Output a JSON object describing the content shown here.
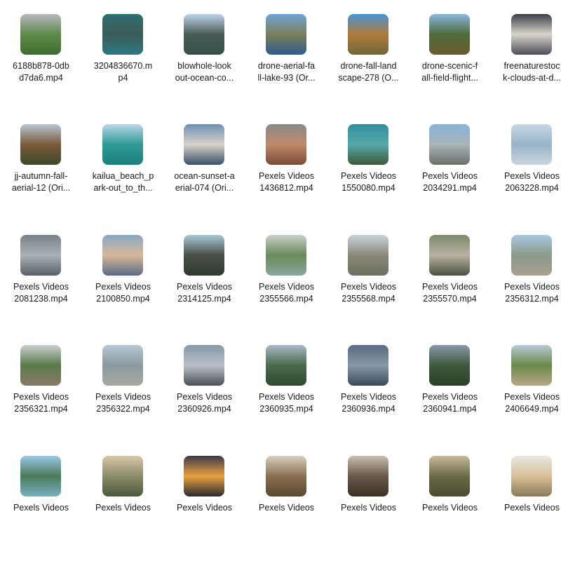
{
  "files": [
    {
      "name": "6188b878-0dbd7da6.mp4",
      "thumb_label": "6188b878-0db\nd7da6.mp4",
      "thumb": {
        "top": "#b8b8c0",
        "mid": "#5e8a4a",
        "bottom": "#3f6b32"
      }
    },
    {
      "name": "3204836670.mp4",
      "thumb_label": "3204836670.m\np4",
      "thumb": {
        "top": "#2f6f73",
        "mid": "#3b5b56",
        "bottom": "#2a7a80"
      }
    },
    {
      "name": "blowhole-lookout-ocean-co...",
      "thumb_label": "blowhole-look\nout-ocean-co...",
      "thumb": {
        "top": "#bcd4ea",
        "mid": "#4a5c56",
        "bottom": "#35504a"
      }
    },
    {
      "name": "drone-aerial-fall-lake-93 (Ori...",
      "thumb_label": "drone-aerial-fa\nll-lake-93 (Or...",
      "thumb": {
        "top": "#6fa5d8",
        "mid": "#7a7f5c",
        "bottom": "#2f5a88"
      }
    },
    {
      "name": "drone-fall-landscape-278 (O...",
      "thumb_label": "drone-fall-land\nscape-278 (O...",
      "thumb": {
        "top": "#4a94d6",
        "mid": "#b07a3a",
        "bottom": "#6d6a3a"
      }
    },
    {
      "name": "drone-scenic-fall-field-flight...",
      "thumb_label": "drone-scenic-f\nall-field-flight...",
      "thumb": {
        "top": "#8ab7e0",
        "mid": "#4f6b3a",
        "bottom": "#6b5a30"
      }
    },
    {
      "name": "freenaturestock-clouds-at-d...",
      "thumb_label": "freenaturestoc\nk-clouds-at-d...",
      "thumb": {
        "top": "#3a3e48",
        "mid": "#d9d4cc",
        "bottom": "#4a4f58"
      }
    },
    {
      "name": "jj-autumn-fall-aerial-12 (Ori...",
      "thumb_label": "jj-autumn-fall-\naerial-12 (Ori...",
      "thumb": {
        "top": "#b7c7d6",
        "mid": "#7a5a38",
        "bottom": "#3e4a2e"
      }
    },
    {
      "name": "kailua_beach_park-out_to_th...",
      "thumb_label": "kailua_beach_p\nark-out_to_th...",
      "thumb": {
        "top": "#bcd7ea",
        "mid": "#2f9a94",
        "bottom": "#1f7f7a"
      }
    },
    {
      "name": "ocean-sunset-aerial-074 (Ori...",
      "thumb_label": "ocean-sunset-a\nerial-074 (Ori...",
      "thumb": {
        "top": "#6f8fb4",
        "mid": "#d8d2c8",
        "bottom": "#3a4e68"
      }
    },
    {
      "name": "Pexels Videos 1436812.mp4",
      "thumb_label": "Pexels Videos\n1436812.mp4",
      "thumb": {
        "top": "#8a8a8a",
        "mid": "#c08a6a",
        "bottom": "#7a4a38"
      }
    },
    {
      "name": "Pexels Videos 1550080.mp4",
      "thumb_label": "Pexels Videos\n1550080.mp4",
      "thumb": {
        "top": "#2f8fa0",
        "mid": "#58a8a8",
        "bottom": "#3b5a3a"
      }
    },
    {
      "name": "Pexels Videos 2034291.mp4",
      "thumb_label": "Pexels Videos\n2034291.mp4",
      "thumb": {
        "top": "#8ab4d8",
        "mid": "#a8b4b8",
        "bottom": "#6a7068"
      }
    },
    {
      "name": "Pexels Videos 2063228.mp4",
      "thumb_label": "Pexels Videos\n2063228.mp4",
      "thumb": {
        "top": "#c8d8e6",
        "mid": "#98b4c8",
        "bottom": "#c8d4de"
      }
    },
    {
      "name": "Pexels Videos 2081238.mp4",
      "thumb_label": "Pexels Videos\n2081238.mp4",
      "thumb": {
        "top": "#7a8088",
        "mid": "#a8b0b8",
        "bottom": "#5a6068"
      }
    },
    {
      "name": "Pexels Videos 2100850.mp4",
      "thumb_label": "Pexels Videos\n2100850.mp4",
      "thumb": {
        "top": "#8aa8c8",
        "mid": "#d8b898",
        "bottom": "#5a6a88"
      }
    },
    {
      "name": "Pexels Videos 2314125.mp4",
      "thumb_label": "Pexels Videos\n2314125.mp4",
      "thumb": {
        "top": "#a8c8d8",
        "mid": "#4a5048",
        "bottom": "#2e3a2e"
      }
    },
    {
      "name": "Pexels Videos 2355566.mp4",
      "thumb_label": "Pexels Videos\n2355566.mp4",
      "thumb": {
        "top": "#c8d0c8",
        "mid": "#6a8a5a",
        "bottom": "#8aa8a0"
      }
    },
    {
      "name": "Pexels Videos 2355568.mp4",
      "thumb_label": "Pexels Videos\n2355568.mp4",
      "thumb": {
        "top": "#c8d4dc",
        "mid": "#8a8878",
        "bottom": "#6a7060"
      }
    },
    {
      "name": "Pexels Videos 2355570.mp4",
      "thumb_label": "Pexels Videos\n2355570.mp4",
      "thumb": {
        "top": "#7a8a6a",
        "mid": "#b8b0a0",
        "bottom": "#4a5040"
      }
    },
    {
      "name": "Pexels Videos 2356312.mp4",
      "thumb_label": "Pexels Videos\n2356312.mp4",
      "thumb": {
        "top": "#a8c8e0",
        "mid": "#8a9a8a",
        "bottom": "#a8a090"
      }
    },
    {
      "name": "Pexels Videos 2356321.mp4",
      "thumb_label": "Pexels Videos\n2356321.mp4",
      "thumb": {
        "top": "#c8d0d0",
        "mid": "#5a7a4a",
        "bottom": "#8a7a68"
      }
    },
    {
      "name": "Pexels Videos 2356322.mp4",
      "thumb_label": "Pexels Videos\n2356322.mp4",
      "thumb": {
        "top": "#b8c8d4",
        "mid": "#8a9aa0",
        "bottom": "#a8a8a0"
      }
    },
    {
      "name": "Pexels Videos 2360926.mp4",
      "thumb_label": "Pexels Videos\n2360926.mp4",
      "thumb": {
        "top": "#8898a8",
        "mid": "#b8c0c8",
        "bottom": "#4a5058"
      }
    },
    {
      "name": "Pexels Videos 2360935.mp4",
      "thumb_label": "Pexels Videos\n2360935.mp4",
      "thumb": {
        "top": "#a8b8c8",
        "mid": "#4a6a4a",
        "bottom": "#2e4a30"
      }
    },
    {
      "name": "Pexels Videos 2360936.mp4",
      "thumb_label": "Pexels Videos\n2360936.mp4",
      "thumb": {
        "top": "#5a6a80",
        "mid": "#8898a8",
        "bottom": "#3a4858"
      }
    },
    {
      "name": "Pexels Videos 2360941.mp4",
      "thumb_label": "Pexels Videos\n2360941.mp4",
      "thumb": {
        "top": "#8898a8",
        "mid": "#3e5a3a",
        "bottom": "#2a4028"
      }
    },
    {
      "name": "Pexels Videos 2406649.mp4",
      "thumb_label": "Pexels Videos\n2406649.mp4",
      "thumb": {
        "top": "#b8c8d8",
        "mid": "#6a8a4a",
        "bottom": "#b8a888"
      }
    },
    {
      "name": "Pexels Videos",
      "thumb_label": "Pexels Videos",
      "thumb": {
        "top": "#9ac8e6",
        "mid": "#4a7a5a",
        "bottom": "#7ab0c0"
      }
    },
    {
      "name": "Pexels Videos",
      "thumb_label": "Pexels Videos",
      "thumb": {
        "top": "#d8c8a8",
        "mid": "#8a8a6a",
        "bottom": "#4a5a3a"
      }
    },
    {
      "name": "Pexels Videos",
      "thumb_label": "Pexels Videos",
      "thumb": {
        "top": "#3a3a48",
        "mid": "#e8a040",
        "bottom": "#2a2a30"
      }
    },
    {
      "name": "Pexels Videos",
      "thumb_label": "Pexels Videos",
      "thumb": {
        "top": "#d8d0c0",
        "mid": "#8a7050",
        "bottom": "#5a4830"
      }
    },
    {
      "name": "Pexels Videos",
      "thumb_label": "Pexels Videos",
      "thumb": {
        "top": "#c8c0b0",
        "mid": "#6a5a48",
        "bottom": "#3a3028"
      }
    },
    {
      "name": "Pexels Videos",
      "thumb_label": "Pexels Videos",
      "thumb": {
        "top": "#c8b898",
        "mid": "#6a6a48",
        "bottom": "#4a4a30"
      }
    },
    {
      "name": "Pexels Videos",
      "thumb_label": "Pexels Videos",
      "thumb": {
        "top": "#e8e8e0",
        "mid": "#d8c098",
        "bottom": "#8a7858"
      }
    }
  ]
}
